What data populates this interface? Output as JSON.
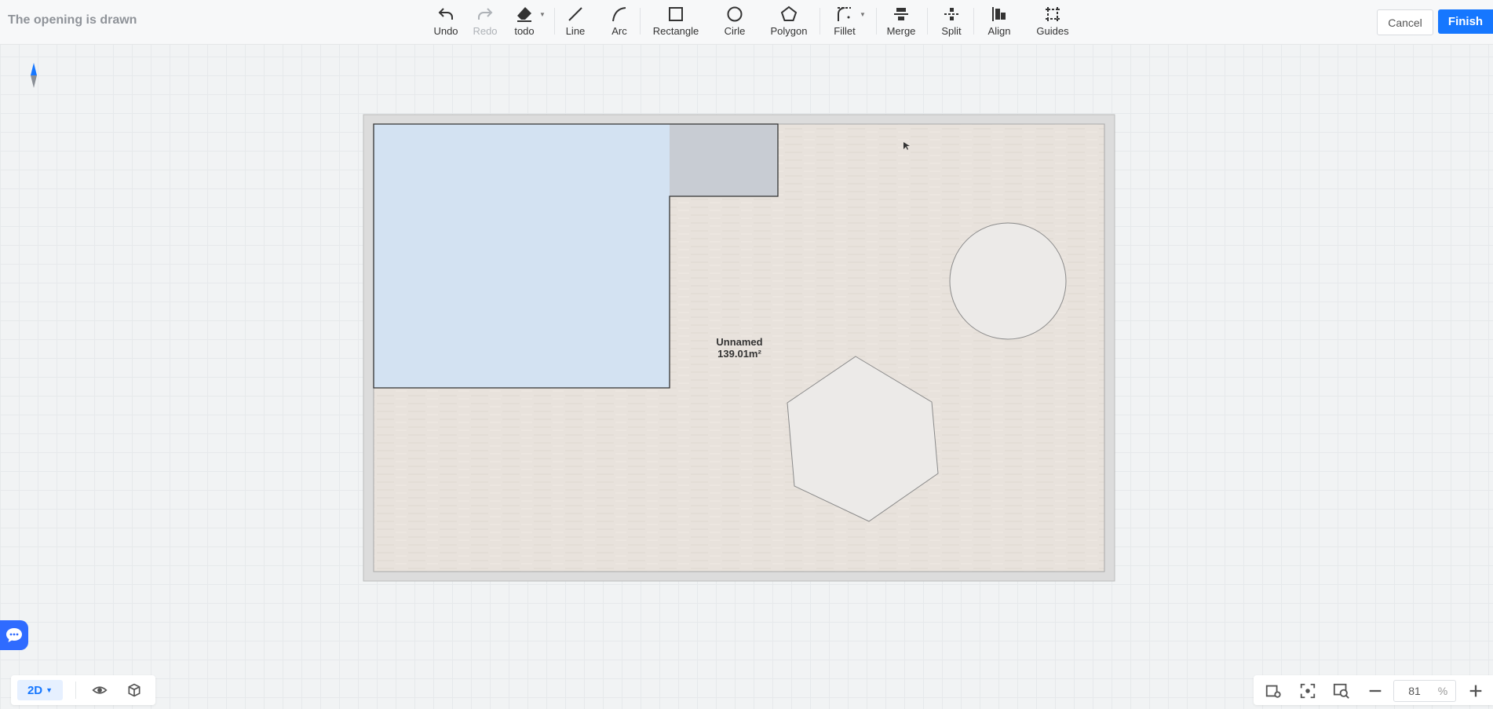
{
  "header": {
    "title": "The opening is drawn",
    "cancel_label": "Cancel",
    "finish_label": "Finish"
  },
  "toolbar": {
    "undo": "Undo",
    "redo": "Redo",
    "todo": "todo",
    "line": "Line",
    "arc": "Arc",
    "rectangle": "Rectangle",
    "circle": "Cirle",
    "polygon": "Polygon",
    "fillet": "Fillet",
    "merge": "Merge",
    "split": "Split",
    "align": "Align",
    "guides": "Guides"
  },
  "room": {
    "name": "Unnamed",
    "area": "139.01m²"
  },
  "view": {
    "mode": "2D",
    "zoom": "81",
    "zoom_unit": "%"
  },
  "colors": {
    "accent": "#1677ff",
    "floor": "#e8e2dc",
    "opening": "#d3e2f2",
    "selected": "#c8ccd3"
  }
}
